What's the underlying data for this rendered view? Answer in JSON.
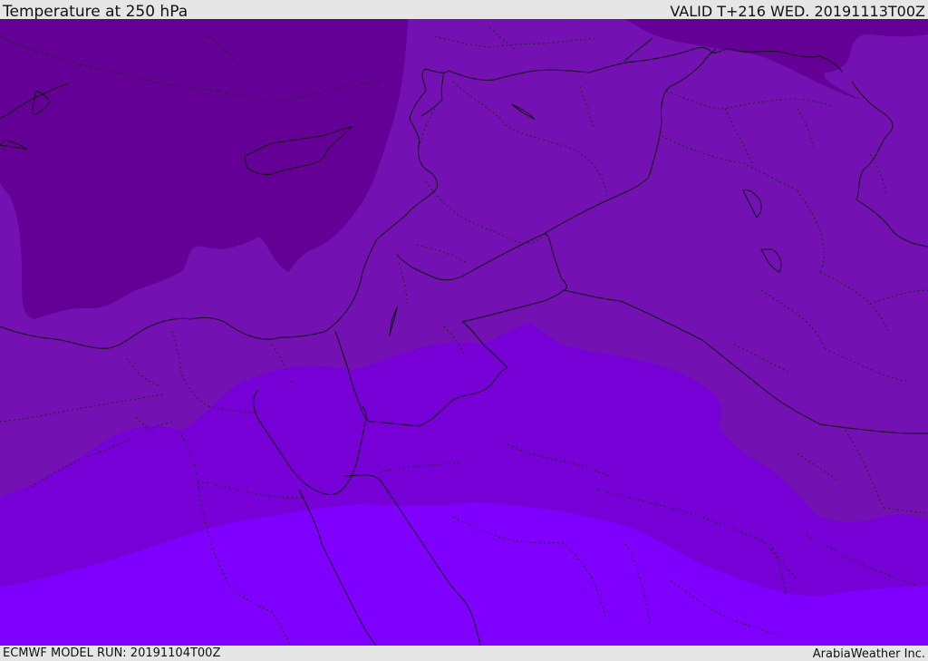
{
  "header": {
    "title": "Temperature at 250 hPa",
    "valid_time": "VALID T+216 WED. 20191113T00Z"
  },
  "footer": {
    "model_run": "ECMWF MODEL RUN: 20191104T00Z",
    "credit": "ArabiaWeather Inc."
  },
  "map": {
    "variable": "temperature",
    "level": "250 hPa",
    "colors": {
      "darkest_band": "#650096",
      "dark_band": "#7311b3",
      "mid_band": "#7700d6",
      "bright_band": "#7f00ff",
      "frame": "#e6e6e6",
      "border_line": "#222222"
    }
  }
}
